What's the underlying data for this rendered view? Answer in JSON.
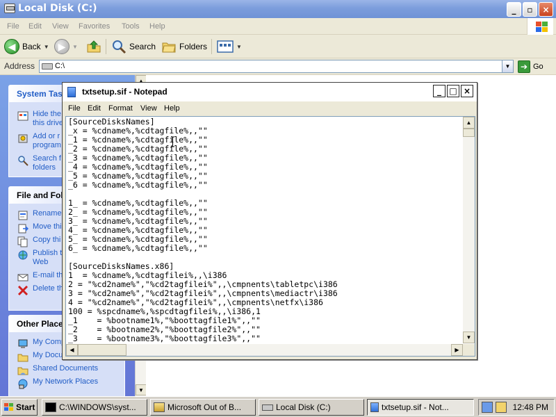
{
  "explorer": {
    "title": "Local Disk (C:)",
    "caption": {
      "minimize": "_",
      "maximize": "▫",
      "close": "×"
    },
    "menu": [
      "File",
      "Edit",
      "View",
      "Favorites",
      "Tools",
      "Help"
    ],
    "toolbar": {
      "back": "Back",
      "search": "Search",
      "folders": "Folders"
    },
    "address": {
      "label": "Address",
      "value": "C:\\",
      "go": "Go"
    },
    "taskpane": {
      "system_tasks": {
        "header": "System Tas",
        "items": [
          {
            "line1": "Hide the",
            "line2": "this drive",
            "icon": "hide-contents-icon"
          },
          {
            "line1": "Add or r",
            "line2": "program",
            "icon": "add-remove-icon"
          },
          {
            "line1": "Search f",
            "line2": "folders",
            "icon": "search-icon"
          }
        ]
      },
      "file_and_folder": {
        "header": "File and Fol",
        "items": [
          {
            "line1": "Rename",
            "icon": "rename-icon"
          },
          {
            "line1": "Move thi",
            "icon": "move-icon"
          },
          {
            "line1": "Copy thi",
            "icon": "copy-icon"
          },
          {
            "line1": "Publish t",
            "line2": "Web",
            "icon": "publish-web-icon"
          },
          {
            "line1": "E-mail th",
            "icon": "email-icon"
          },
          {
            "line1": "Delete th",
            "icon": "delete-icon"
          }
        ]
      },
      "other_places": {
        "header": "Other Place",
        "items": [
          {
            "line1": "My Comp",
            "icon": "my-computer-icon"
          },
          {
            "line1": "My Docu",
            "icon": "my-documents-icon"
          },
          {
            "line1": "Shared Documents",
            "icon": "shared-documents-icon"
          },
          {
            "line1": "My Network Places",
            "icon": "network-places-icon"
          }
        ]
      }
    }
  },
  "notepad": {
    "title": "txtsetup.sif - Notepad",
    "caption": {
      "minimize": "_",
      "maximize": "□",
      "close": "×"
    },
    "menu": [
      "File",
      "Edit",
      "Format",
      "View",
      "Help"
    ],
    "lines": [
      "[SourceDisksNames]",
      "_x = %cdname%,%cdtagfile%,,\"\"",
      "_1 = %cdname%,%cdtagfile%,,\"\"",
      "_2 = %cdname%,%cdtagfile%,,\"\"",
      "_3 = %cdname%,%cdtagfile%,,\"\"",
      "_4 = %cdname%,%cdtagfile%,,\"\"",
      "_5 = %cdname%,%cdtagfile%,,\"\"",
      "_6 = %cdname%,%cdtagfile%,,\"\"",
      "",
      "1_ = %cdname%,%cdtagfile%,,\"\"",
      "2_ = %cdname%,%cdtagfile%,,\"\"",
      "3_ = %cdname%,%cdtagfile%,,\"\"",
      "4_ = %cdname%,%cdtagfile%,,\"\"",
      "5_ = %cdname%,%cdtagfile%,,\"\"",
      "6_ = %cdname%,%cdtagfile%,,\"\"",
      "",
      "[SourceDisksNames.x86]",
      "1  = %cdname%,%cdtagfilei%,,\\i386",
      "2 = \"%cd2name%\",\"%cd2tagfilei%\",,\\cmpnents\\tabletpc\\i386",
      "3 = \"%cd2name%\",\"%cd2tagfilei%\",,\\cmpnents\\mediactr\\i386",
      "4 = \"%cd2name%\",\"%cd2tagfilei%\",,\\cmpnents\\netfx\\i386",
      "100 = %spcdname%,%spcdtagfilei%,,\\i386,1",
      "_1    = %bootname1%,\"%boottagfile1%\",,\"\"",
      "_2    = %bootname2%,\"%boottagfile2%\",,\"\"",
      "_3    = %bootname3%,\"%boottagfile3%\",,\"\""
    ]
  },
  "taskbar": {
    "start": "Start",
    "tasks": [
      {
        "label": "C:\\WINDOWS\\syst...",
        "icon": "cmd-icon",
        "active": false
      },
      {
        "label": "Microsoft Out of B...",
        "icon": "oobe-icon",
        "active": false
      },
      {
        "label": "Local Disk (C:)",
        "icon": "drive-icon",
        "active": false
      },
      {
        "label": "txtsetup.sif - Not...",
        "icon": "notepad-icon",
        "active": true
      }
    ],
    "clock": "12:48 PM"
  }
}
